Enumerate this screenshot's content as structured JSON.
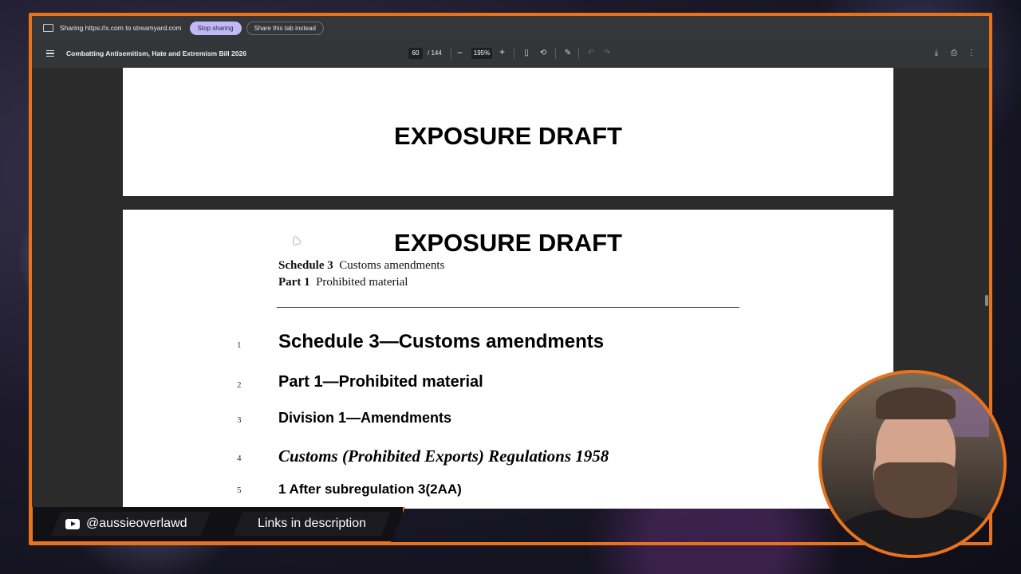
{
  "sharebar": {
    "text": "Sharing https://x.com to streamyard.com",
    "stop_label": "Stop sharing",
    "share_tab_label": "Share this tab instead"
  },
  "toolbar": {
    "title": "Combatting Antisemitism, Hate and Extremism Bill 2026",
    "page_current": "60",
    "page_total": "/ 144",
    "zoom": "195%",
    "zoom_minus": "−",
    "zoom_plus": "+"
  },
  "document": {
    "page1_title": "EXPOSURE DRAFT",
    "page2_title": "EXPOSURE DRAFT",
    "header_schedule_bold": "Schedule 3",
    "header_schedule_text": "Customs amendments",
    "header_part_bold": "Part 1",
    "header_part_text": "Prohibited material",
    "lines": [
      {
        "no": "1",
        "text": "Schedule 3—Customs amendments"
      },
      {
        "no": "2",
        "text": "Part 1—Prohibited material"
      },
      {
        "no": "3",
        "text": "Division 1—Amendments"
      },
      {
        "no": "4",
        "text": "Customs (Prohibited Exports) Regulations 1958"
      },
      {
        "no": "5",
        "text": "1  After subregulation 3(2AA)"
      }
    ]
  },
  "overlay": {
    "handle": "@aussieoverlawd",
    "links": "Links in description"
  },
  "colors": {
    "frame_accent": "#e8731c",
    "stop_button": "#c2b8f5"
  }
}
